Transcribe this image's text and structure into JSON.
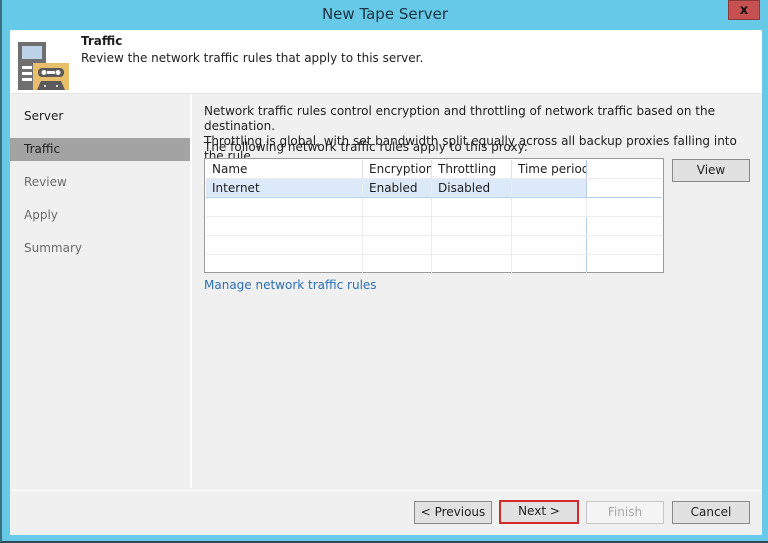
{
  "window": {
    "title": "New Tape Server",
    "close_label": "x"
  },
  "header": {
    "icon": "tape-server-icon",
    "title": "Traffic",
    "subtitle": "Review the network traffic rules that apply to this server."
  },
  "steps": [
    {
      "label": "Server",
      "state": "done"
    },
    {
      "label": "Traffic",
      "state": "active"
    },
    {
      "label": "Review",
      "state": "pending"
    },
    {
      "label": "Apply",
      "state": "pending"
    },
    {
      "label": "Summary",
      "state": "pending"
    }
  ],
  "content": {
    "description_line1": "Network traffic rules control encryption and throttling of network traffic based on the destination.",
    "description_line2": "Throttling is global, with set bandwidth split equally across all backup proxies falling into the rule.",
    "proxy_label": "The following network traffic rules apply to this proxy:",
    "table": {
      "columns": [
        "Name",
        "Encryption",
        "Throttling",
        "Time period"
      ],
      "rows": [
        {
          "name": "Internet",
          "encryption": "Enabled",
          "throttling": "Disabled",
          "time_period": "",
          "selected": true
        }
      ]
    },
    "view_button": "View",
    "manage_link": "Manage network traffic rules"
  },
  "footer": {
    "previous": "< Previous",
    "next": "Next >",
    "finish": "Finish",
    "cancel": "Cancel"
  },
  "colors": {
    "window_frame": "#66c9e8",
    "close_button": "#c75050",
    "link": "#2a6fb5",
    "selected_row": "#dbe9f9",
    "next_highlight": "#d12a2a"
  }
}
